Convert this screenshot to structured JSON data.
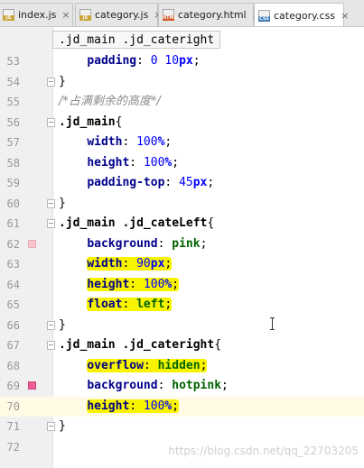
{
  "tabs": [
    {
      "label": "index.js",
      "icon": "js-file-icon",
      "badge": "JS",
      "active": false
    },
    {
      "label": "category.js",
      "icon": "js-file-icon",
      "badge": "JS",
      "active": false
    },
    {
      "label": "category.html",
      "icon": "html-file-icon",
      "badge": "HTML",
      "active": false
    },
    {
      "label": "category.css",
      "icon": "css-file-icon",
      "badge": "CSS",
      "active": true
    }
  ],
  "close_glyph": "×",
  "breadcrumb": ".jd_main .jd_cateright",
  "lines": [
    {
      "n": "53",
      "tokens": [
        [
          "    ",
          ""
        ],
        [
          "padding",
          "prop"
        ],
        [
          ": ",
          "punct"
        ],
        [
          "0 ",
          "num-v"
        ],
        [
          "10",
          "num-v"
        ],
        [
          "px",
          "unit"
        ],
        [
          ";",
          "punct"
        ]
      ]
    },
    {
      "n": "54",
      "fold": true,
      "tokens": [
        [
          "}",
          "punct"
        ]
      ]
    },
    {
      "n": "55",
      "tokens": [
        [
          "/*占满剩余的高度*/",
          "comment"
        ]
      ]
    },
    {
      "n": "56",
      "fold": true,
      "tokens": [
        [
          ".jd_main",
          "sel"
        ],
        [
          "{",
          "punct"
        ]
      ]
    },
    {
      "n": "57",
      "tokens": [
        [
          "    ",
          ""
        ],
        [
          "width",
          "prop"
        ],
        [
          ": ",
          "punct"
        ],
        [
          "100",
          "num-v"
        ],
        [
          "%",
          "unit"
        ],
        [
          ";",
          "punct"
        ]
      ]
    },
    {
      "n": "58",
      "tokens": [
        [
          "    ",
          ""
        ],
        [
          "height",
          "prop"
        ],
        [
          ": ",
          "punct"
        ],
        [
          "100",
          "num-v"
        ],
        [
          "%",
          "unit"
        ],
        [
          ";",
          "punct"
        ]
      ]
    },
    {
      "n": "59",
      "tokens": [
        [
          "    ",
          ""
        ],
        [
          "padding-top",
          "prop"
        ],
        [
          ": ",
          "punct"
        ],
        [
          "45",
          "num-v"
        ],
        [
          "px",
          "unit"
        ],
        [
          ";",
          "punct"
        ]
      ]
    },
    {
      "n": "60",
      "fold": true,
      "tokens": [
        [
          "}",
          "punct"
        ]
      ]
    },
    {
      "n": "61",
      "fold": true,
      "tokens": [
        [
          ".jd_main .jd_cateLeft",
          "sel"
        ],
        [
          "{",
          "punct"
        ]
      ]
    },
    {
      "n": "62",
      "marker": "light",
      "tokens": [
        [
          "    ",
          ""
        ],
        [
          "background",
          "prop"
        ],
        [
          ": ",
          "punct"
        ],
        [
          "pink",
          "val"
        ],
        [
          ";",
          "punct"
        ]
      ]
    },
    {
      "n": "63",
      "highlight": true,
      "tokens": [
        [
          "    ",
          ""
        ],
        [
          "width",
          "prop"
        ],
        [
          ": ",
          "punct"
        ],
        [
          "90",
          "num-v"
        ],
        [
          "px",
          "unit"
        ],
        [
          ";",
          "punct"
        ]
      ]
    },
    {
      "n": "64",
      "highlight": true,
      "tokens": [
        [
          "    ",
          ""
        ],
        [
          "height",
          "prop"
        ],
        [
          ": ",
          "punct"
        ],
        [
          "100",
          "num-v"
        ],
        [
          "%",
          "unit"
        ],
        [
          ";",
          "punct"
        ]
      ]
    },
    {
      "n": "65",
      "highlight": true,
      "tokens": [
        [
          "    ",
          ""
        ],
        [
          "float",
          "prop"
        ],
        [
          ": ",
          "punct"
        ],
        [
          "left",
          "val"
        ],
        [
          ";",
          "punct"
        ]
      ]
    },
    {
      "n": "66",
      "fold": true,
      "tokens": [
        [
          "}",
          "punct"
        ]
      ]
    },
    {
      "n": "67",
      "fold": true,
      "tokens": [
        [
          ".jd_main .jd_cateright",
          "sel"
        ],
        [
          "{",
          "punct"
        ]
      ]
    },
    {
      "n": "68",
      "highlight": true,
      "tokens": [
        [
          "    ",
          ""
        ],
        [
          "overflow",
          "prop"
        ],
        [
          ": ",
          "punct"
        ],
        [
          "hidden",
          "val"
        ],
        [
          ";",
          "punct"
        ]
      ]
    },
    {
      "n": "69",
      "marker": "strong",
      "tokens": [
        [
          "    ",
          ""
        ],
        [
          "background",
          "prop"
        ],
        [
          ": ",
          "punct"
        ],
        [
          "hotpink",
          "val"
        ],
        [
          ";",
          "punct"
        ]
      ]
    },
    {
      "n": "70",
      "highlight": true,
      "current": true,
      "tokens": [
        [
          "    ",
          ""
        ],
        [
          "height",
          "prop"
        ],
        [
          ": ",
          "punct"
        ],
        [
          "100",
          "num-v"
        ],
        [
          "%",
          "unit"
        ],
        [
          ";",
          "punct"
        ]
      ]
    },
    {
      "n": "71",
      "fold": true,
      "tokens": [
        [
          "}",
          "punct"
        ]
      ]
    },
    {
      "n": "72",
      "tokens": []
    }
  ],
  "watermark": "https://blog.csdn.net/qq_22703205",
  "colors": {
    "highlight": "#f8f400",
    "current_line": "#fffae3",
    "property": "#00008b",
    "value": "#006400",
    "number": "#0000ff",
    "comment": "#8c8c8c"
  }
}
